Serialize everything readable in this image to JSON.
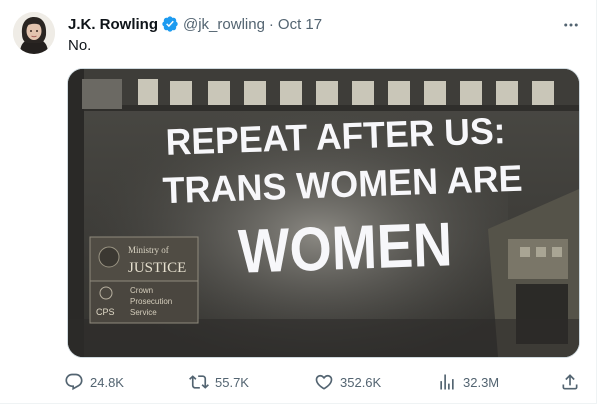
{
  "tweet": {
    "author": {
      "name": "J.K. Rowling",
      "handle": "@jk_rowling",
      "separator": "·",
      "date": "Oct 17",
      "verified_icon": "verified-badge-icon"
    },
    "text": "No.",
    "media": {
      "projection_lines": [
        "REPEAT AFTER US:",
        "TRANS WOMEN ARE",
        "WOMEN"
      ],
      "signs": {
        "moj_line1": "Ministry of",
        "moj_line2": "JUSTICE",
        "cps_abbrev": "CPS",
        "cps_line1": "Crown",
        "cps_line2": "Prosecution",
        "cps_line3": "Service"
      }
    },
    "actions": {
      "reply": {
        "count": "24.8K",
        "icon": "reply-icon"
      },
      "retweet": {
        "count": "55.7K",
        "icon": "retweet-icon"
      },
      "like": {
        "count": "352.6K",
        "icon": "like-icon"
      },
      "views": {
        "count": "32.3M",
        "icon": "views-icon"
      },
      "share": {
        "icon": "share-icon"
      }
    },
    "more_icon": "more-icon"
  },
  "colors": {
    "text_primary": "#0f1419",
    "text_secondary": "#536471",
    "verified": "#1d9bf0",
    "border": "#cfd9de"
  }
}
